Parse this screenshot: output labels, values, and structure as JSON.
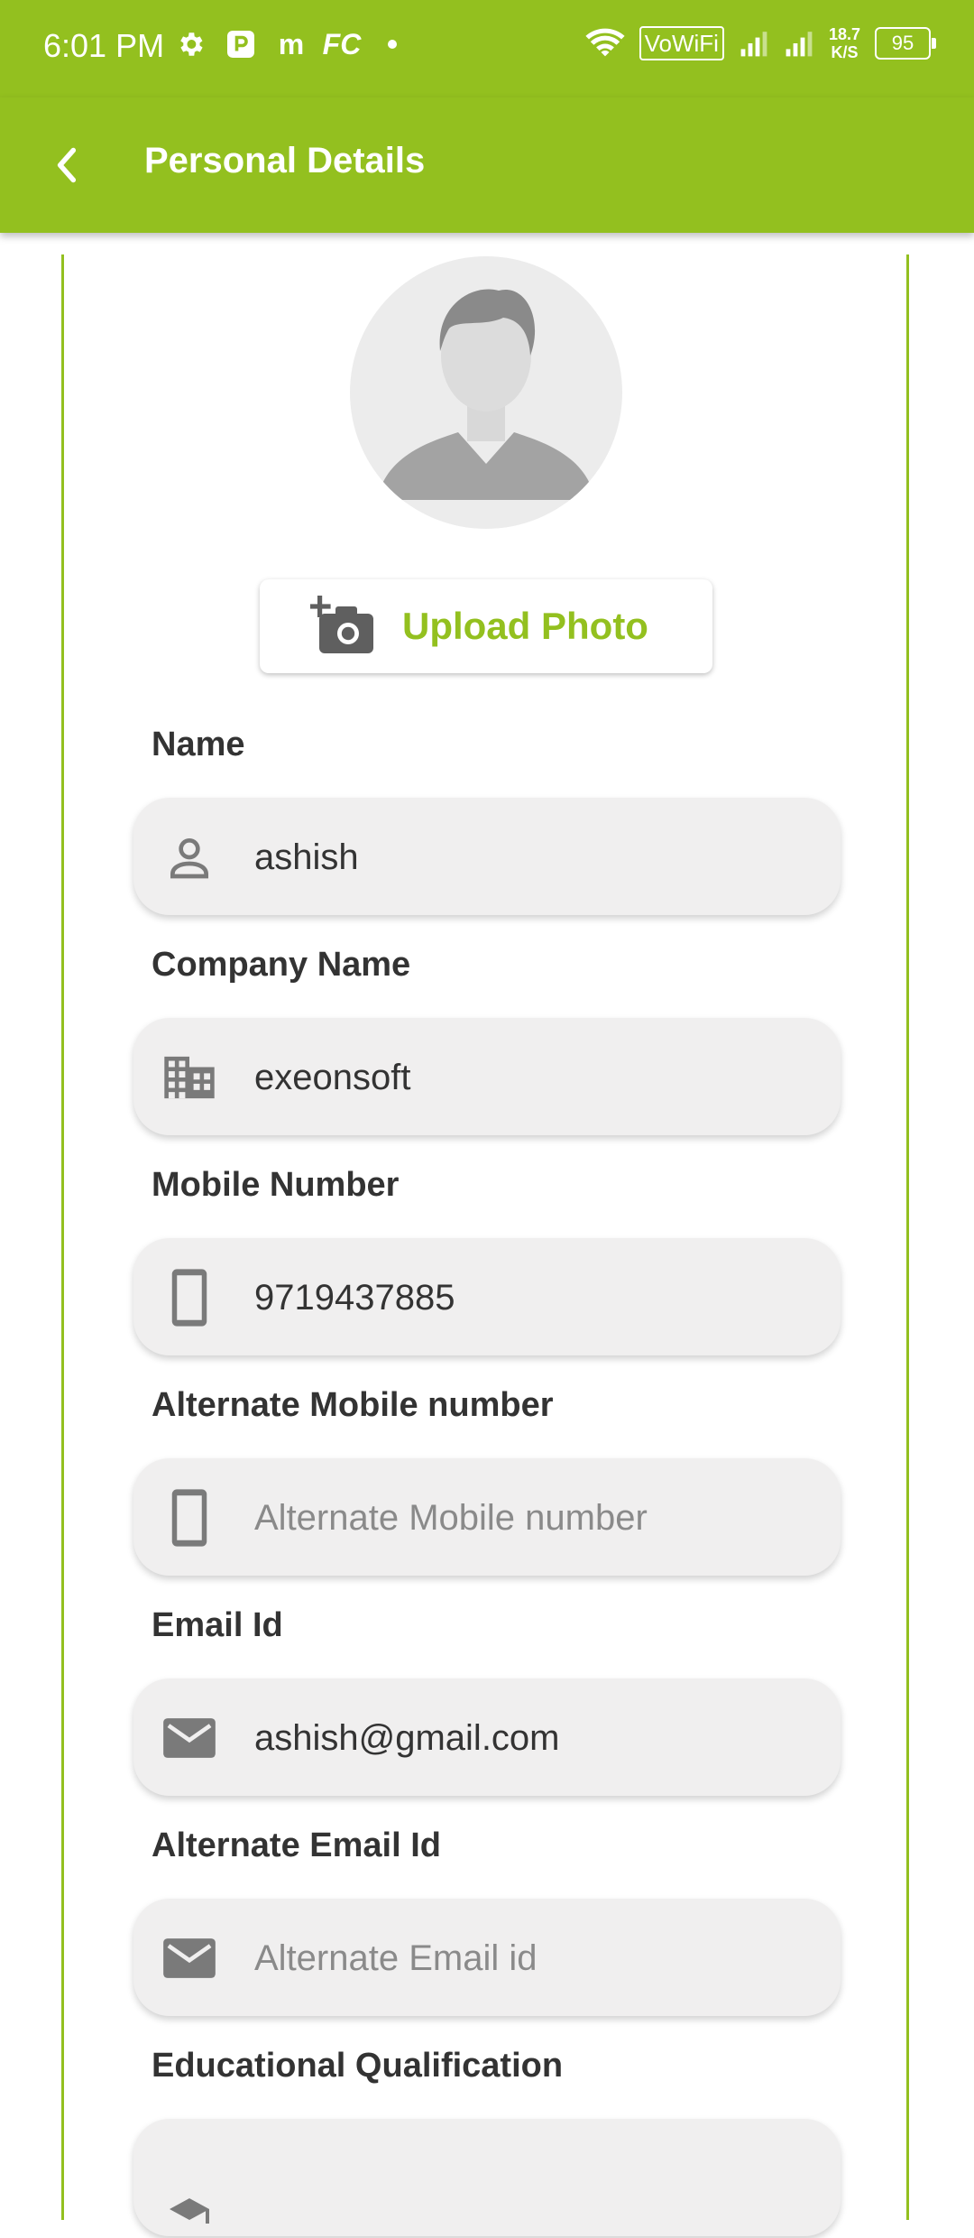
{
  "status_bar": {
    "time": "6:01 PM",
    "left_icons": [
      "settings-icon",
      "parking-app-icon",
      "m-app-icon",
      "fc-app-icon",
      "dot-icon"
    ],
    "vowifi": "VoWiFi",
    "speed_value": "18.7",
    "speed_unit": "K/S",
    "battery": "95"
  },
  "app_bar": {
    "title": "Personal Details",
    "back_icon": "chevron-left-icon"
  },
  "profile": {
    "avatar_icon": "person-placeholder-icon",
    "upload_label": "Upload Photo",
    "upload_icon": "add-photo-camera-icon"
  },
  "fields": {
    "name": {
      "label": "Name",
      "value": "ashish",
      "placeholder": "",
      "icon": "person-icon"
    },
    "company": {
      "label": "Company Name",
      "value": "exeonsoft",
      "placeholder": "",
      "icon": "building-icon"
    },
    "mobile": {
      "label": "Mobile Number",
      "value": "9719437885",
      "placeholder": "",
      "icon": "phone-icon"
    },
    "alt_mobile": {
      "label": "Alternate Mobile number",
      "value": "",
      "placeholder": "Alternate Mobile number",
      "icon": "phone-icon"
    },
    "email": {
      "label": "Email Id",
      "value": "ashish@gmail.com",
      "placeholder": "",
      "icon": "mail-icon"
    },
    "alt_email": {
      "label": "Alternate Email Id",
      "value": "",
      "placeholder": "Alternate Email id",
      "icon": "mail-icon"
    },
    "education": {
      "label": "Educational Qualification",
      "value": "",
      "placeholder": "",
      "icon": "school-icon"
    }
  },
  "colors": {
    "accent": "#93c01f",
    "field_bg": "#f0efef",
    "icon_gray": "#7a7a7a",
    "text_dark": "#333333"
  }
}
